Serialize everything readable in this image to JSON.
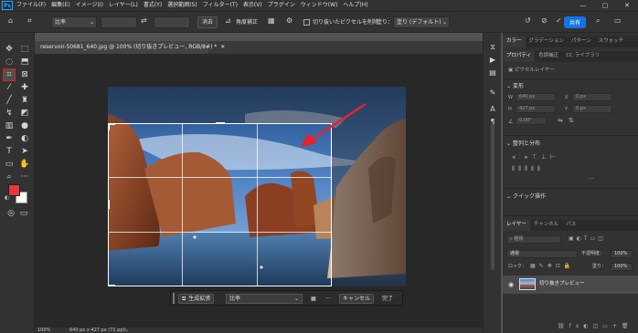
{
  "app": {
    "logo": "Ps"
  },
  "menu": [
    "ファイル(F)",
    "編集(E)",
    "イメージ(I)",
    "レイヤー(L)",
    "書式(Y)",
    "選択範囲(S)",
    "フィルター(T)",
    "表示(V)",
    "プラグイン",
    "ウィンドウ(W)",
    "ヘルプ(H)"
  ],
  "window_controls": {
    "minimize": "—",
    "maximize": "▢",
    "close": "✕"
  },
  "options": {
    "ratio_value": "比率",
    "clear_label": "消去",
    "straighten_label": "角度補正",
    "delete_cropped_label": "切り抜いたピクセルを削除",
    "fill_label": "塗り：",
    "fill_value": "塗り (デフォルト)",
    "share_label": "共有"
  },
  "document": {
    "tab_title": "reservoir-50681_640.jpg @ 100% (切り抜きプレビュー, RGB/8#) *"
  },
  "status": {
    "zoom": "100%",
    "dimensions": "640 px x 427 px (72 ppi)"
  },
  "contextbar": {
    "generative_expand_label": "生成拡張",
    "ratio_value": "比率",
    "more_label": "···",
    "cancel_label": "キャンセル",
    "done_label": "完了"
  },
  "panels": {
    "top_tabs": [
      "カラー",
      "グラデーション",
      "パターン",
      "スウォッチ"
    ],
    "props_tabs": [
      "プロパティ",
      "色調補正",
      "CC ライブラリ"
    ],
    "layer_type": "ピクセルレイヤー",
    "transform_title": "変形",
    "transform": {
      "w": "640 px",
      "x": "0 px",
      "h": "427 px",
      "y": "0 px",
      "angle": "0.00°"
    },
    "align_title": "整列と分布",
    "more_label": "···",
    "quick_actions_title": "クイック操作",
    "layer_tabs": [
      "レイヤー",
      "チャンネル",
      "パス"
    ],
    "search_placeholder": "種類",
    "blend_mode": "通常",
    "opacity_label": "不透明度：",
    "opacity_value": "100%",
    "lock_label": "ロック：",
    "fill_label": "塗り：",
    "fill_value": "100%",
    "layer_name": "切り抜きプレビュー"
  },
  "colors": {
    "foreground": "#e8373a",
    "background": "#ffffff",
    "accent": "#1473e6",
    "highlight": "#e02020"
  }
}
